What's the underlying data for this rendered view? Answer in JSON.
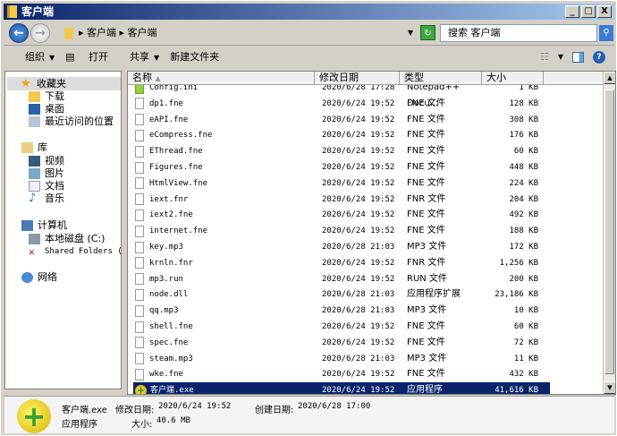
{
  "window": {
    "title": "客户端",
    "buttons": [
      "_",
      "□",
      "X"
    ]
  },
  "address": {
    "crumbs": "▸ 客户端 ▸ 客户端",
    "search_placeholder": "搜索 客户端"
  },
  "toolbar": {
    "organize": "组织",
    "open": "打开",
    "share": "共享",
    "new_folder": "新建文件夹"
  },
  "sidebar": {
    "favorites": "收藏夹",
    "downloads": "下载",
    "desktop": "桌面",
    "recent": "最近访问的位置",
    "libraries": "库",
    "videos": "视频",
    "pictures": "图片",
    "documents": "文档",
    "music": "音乐",
    "computer": "计算机",
    "local_disk": "本地磁盘 (C:)",
    "shared": "Shared Folders (\\\\",
    "network": "网络"
  },
  "columns": {
    "name": "名称",
    "date": "修改日期",
    "type": "类型",
    "size": "大小"
  },
  "files": [
    {
      "name": "Config.ini",
      "date": "2020/6/28 17:28",
      "type": "Notepad++ Docu...",
      "size": "1 KB"
    },
    {
      "name": "dp1.fne",
      "date": "2020/6/24 19:52",
      "type": "FNE 文件",
      "size": "128 KB"
    },
    {
      "name": "eAPI.fne",
      "date": "2020/6/24 19:52",
      "type": "FNE 文件",
      "size": "308 KB"
    },
    {
      "name": "eCompress.fne",
      "date": "2020/6/24 19:52",
      "type": "FNE 文件",
      "size": "176 KB"
    },
    {
      "name": "EThread.fne",
      "date": "2020/6/24 19:52",
      "type": "FNE 文件",
      "size": "60 KB"
    },
    {
      "name": "Figures.fne",
      "date": "2020/6/24 19:52",
      "type": "FNE 文件",
      "size": "448 KB"
    },
    {
      "name": "HtmlView.fne",
      "date": "2020/6/24 19:52",
      "type": "FNE 文件",
      "size": "224 KB"
    },
    {
      "name": "iext.fnr",
      "date": "2020/6/24 19:52",
      "type": "FNR 文件",
      "size": "204 KB"
    },
    {
      "name": "iext2.fne",
      "date": "2020/6/24 19:52",
      "type": "FNE 文件",
      "size": "492 KB"
    },
    {
      "name": "internet.fne",
      "date": "2020/6/24 19:52",
      "type": "FNE 文件",
      "size": "188 KB"
    },
    {
      "name": "key.mp3",
      "date": "2020/6/28 21:03",
      "type": "MP3 文件",
      "size": "172 KB"
    },
    {
      "name": "krnln.fnr",
      "date": "2020/6/24 19:52",
      "type": "FNR 文件",
      "size": "1,256 KB"
    },
    {
      "name": "mp3.run",
      "date": "2020/6/24 19:52",
      "type": "RUN 文件",
      "size": "200 KB"
    },
    {
      "name": "node.dll",
      "date": "2020/6/28 21:03",
      "type": "应用程序扩展",
      "size": "23,186 KB"
    },
    {
      "name": "qq.mp3",
      "date": "2020/6/28 21:03",
      "type": "MP3 文件",
      "size": "10 KB"
    },
    {
      "name": "shell.fne",
      "date": "2020/6/24 19:52",
      "type": "FNE 文件",
      "size": "60 KB"
    },
    {
      "name": "spec.fne",
      "date": "2020/6/24 19:52",
      "type": "FNE 文件",
      "size": "72 KB"
    },
    {
      "name": "steam.mp3",
      "date": "2020/6/28 21:03",
      "type": "MP3 文件",
      "size": "11 KB"
    },
    {
      "name": "wke.fne",
      "date": "2020/6/24 19:52",
      "type": "FNE 文件",
      "size": "432 KB"
    },
    {
      "name": "客户端.exe",
      "date": "2020/6/24 19:52",
      "type": "应用程序",
      "size": "41,616 KB"
    }
  ],
  "details": {
    "name": "客户端.exe",
    "modified_label": "修改日期:",
    "modified": "2020/6/24 19:52",
    "created_label": "创建日期:",
    "created": "2020/6/28 17:00",
    "type": "应用程序",
    "size_label": "大小:",
    "size": "40.6 MB"
  }
}
